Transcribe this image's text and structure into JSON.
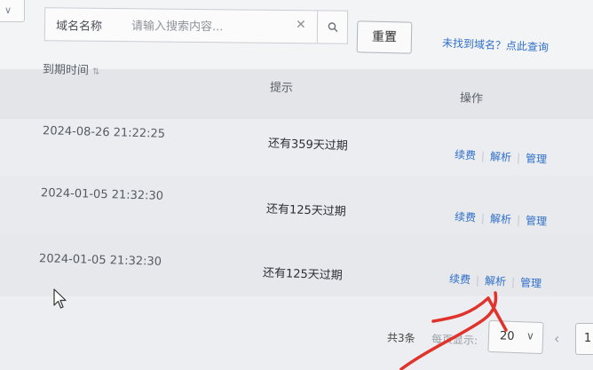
{
  "filter": {
    "field_label": "域名名称",
    "search_placeholder": "请输入搜索内容...",
    "reset_label": "重置",
    "help_link": "未找到域名？点此查询"
  },
  "table": {
    "columns": {
      "expire": "到期时间",
      "tip": "提示",
      "ops": "操作"
    },
    "rows": [
      {
        "expire": "2024-08-26 21:22:25",
        "tip": "还有359天过期",
        "renew": "续费",
        "dns": "解析",
        "manage": "管理"
      },
      {
        "expire": "2024-01-05 21:32:30",
        "tip": "还有125天过期",
        "renew": "续费",
        "dns": "解析",
        "manage": "管理"
      },
      {
        "expire": "2024-01-05 21:32:30",
        "tip": "还有125天过期",
        "renew": "续费",
        "dns": "解析",
        "manage": "管理"
      }
    ]
  },
  "pagination": {
    "total": "共3条",
    "per_page_label": "每页显示:",
    "page_size": "20",
    "current_page": "1"
  },
  "colors": {
    "link": "#2f6fc9",
    "annotation": "#e0332b"
  }
}
